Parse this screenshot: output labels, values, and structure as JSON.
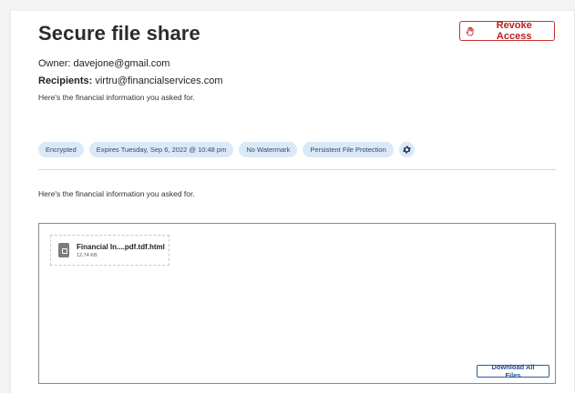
{
  "page": {
    "title": "Secure file share",
    "revoke_label": "Revoke Access",
    "owner_label": "Owner:",
    "owner_value": "davejone@gmail.com",
    "recipients_label": "Recipients:",
    "recipients_value": "virtru@financialservices.com",
    "message": "Here's the financial information you asked for.",
    "tags": [
      "Encrypted",
      "Expires Tuesday, Sep 6, 2022 @ 10:48 pm",
      "No Watermark",
      "Persistent File Protection"
    ],
    "settings_icon": "gear-icon",
    "message_body": "Here's the financial information you asked for."
  },
  "files": {
    "items": [
      {
        "name": "Financial In....pdf.tdf.html",
        "size": "12.74 KB",
        "icon": "file-lock-icon"
      }
    ],
    "download_all_label": "Download All Files"
  },
  "colors": {
    "accent_red": "#c8322e",
    "tag_bg": "#dbe8f7",
    "download_blue": "#2d5a9a"
  }
}
